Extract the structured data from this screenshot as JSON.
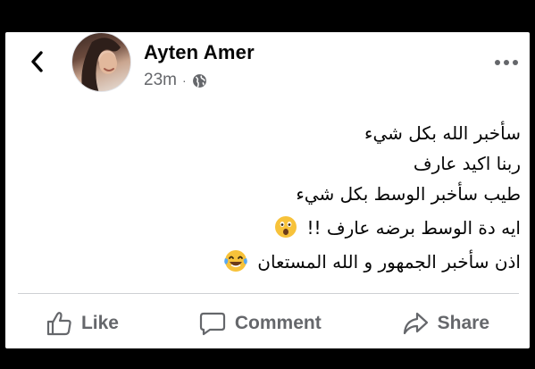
{
  "post": {
    "author": "Ayten Amer",
    "time": "23m",
    "separator": "·",
    "privacy_icon": "globe-icon",
    "lines": [
      "سأخبر الله بكل شيء",
      "ربنا اكيد عارف",
      "طيب سأخبر الوسط بكل شيء",
      "ايه دة الوسط برضه عارف !!",
      "اذن سأخبر الجمهور و الله المستعان"
    ],
    "emoji": {
      "line4": "astonished-face",
      "line5": "tears-of-joy-face"
    }
  },
  "actions": {
    "like_label": "Like",
    "comment_label": "Comment",
    "share_label": "Share"
  },
  "icons": {
    "back": "chevron-left-icon",
    "more": "more-options-icon"
  },
  "colors": {
    "text": "#050505",
    "secondary": "#65676b",
    "divider": "#ced0d4",
    "background": "#ffffff",
    "frame": "#000000"
  }
}
